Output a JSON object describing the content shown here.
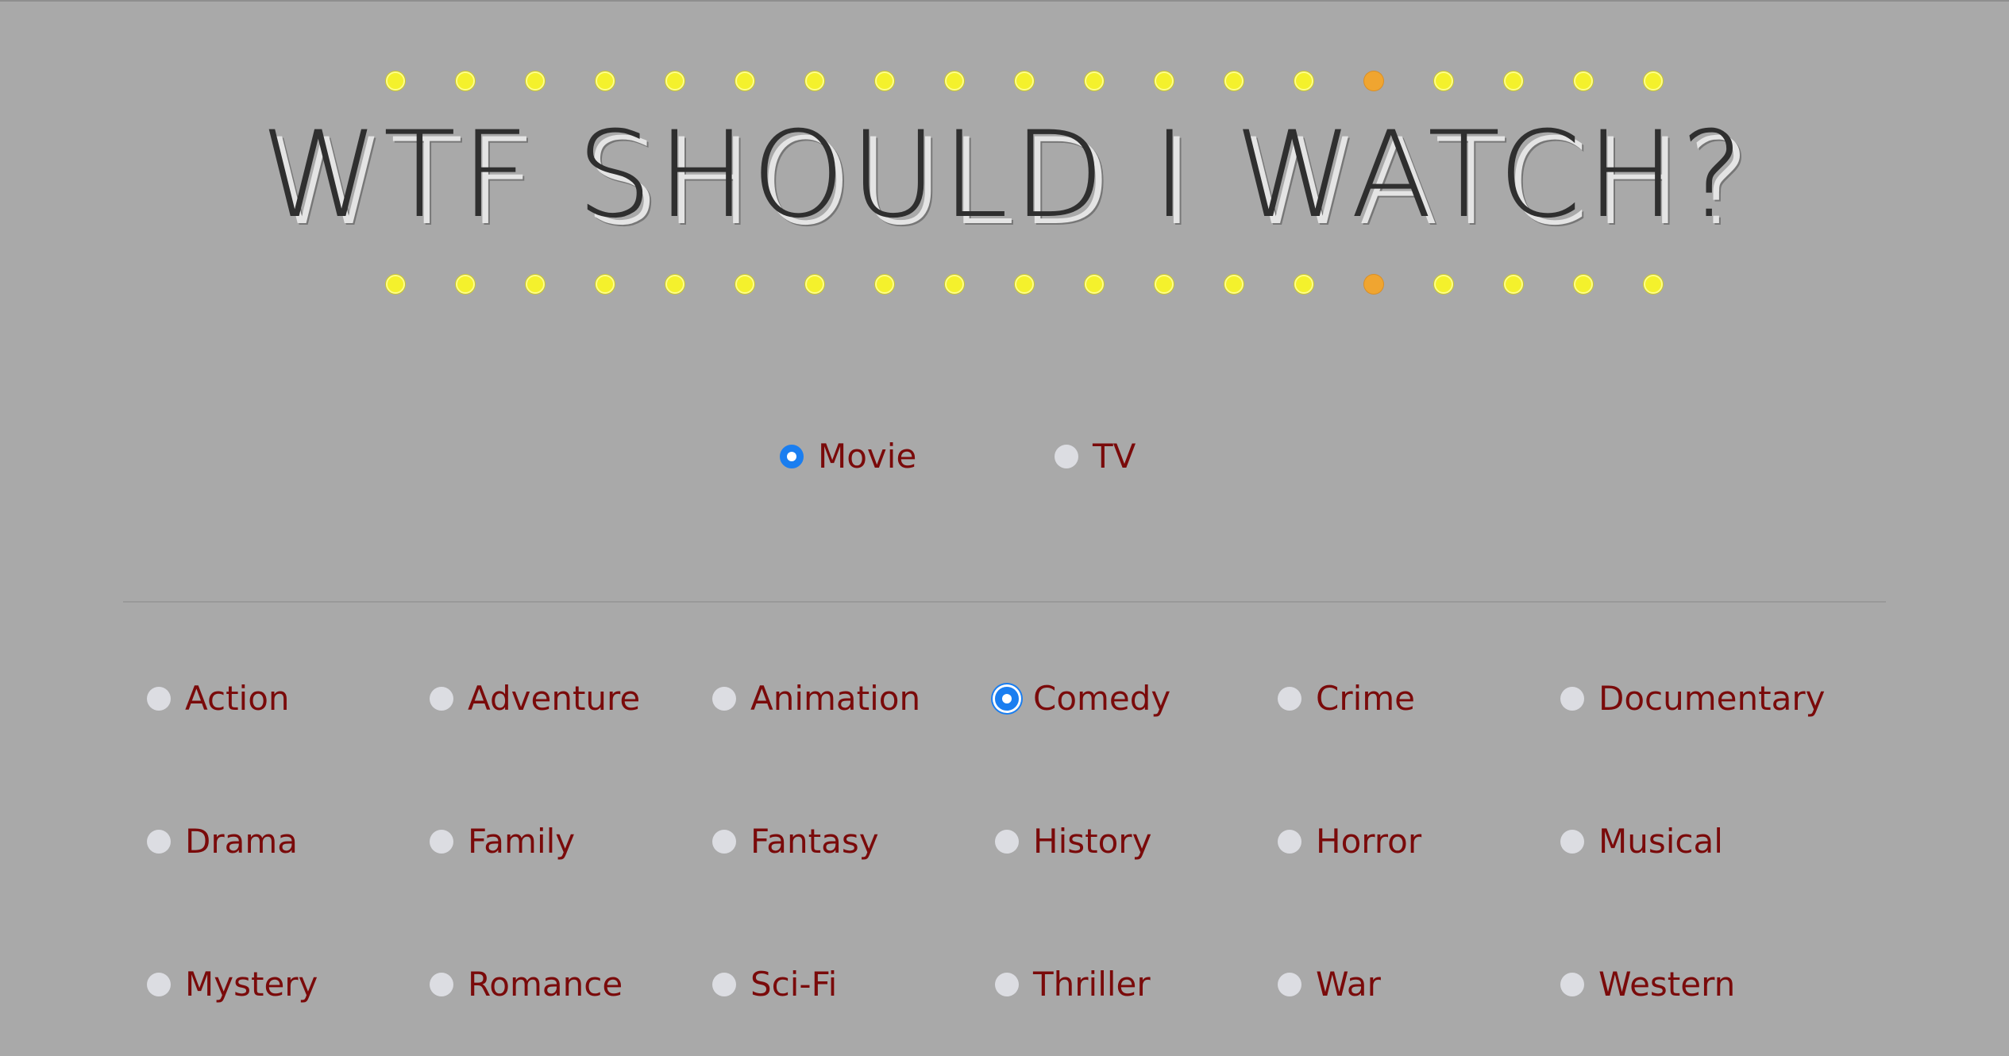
{
  "header": {
    "title": "WTF SHOULD I WATCH?",
    "marquee_bulbs_per_row": 19,
    "highlighted_bulb_number": 15,
    "colors": {
      "bulb": "#f4f12c",
      "bulb_highlight": "#f0a530"
    }
  },
  "media_type": {
    "options": [
      {
        "label": "Movie",
        "checked": true
      },
      {
        "label": "TV",
        "checked": false
      }
    ]
  },
  "genres": {
    "options": [
      {
        "label": "Action",
        "checked": false
      },
      {
        "label": "Adventure",
        "checked": false
      },
      {
        "label": "Animation",
        "checked": false
      },
      {
        "label": "Comedy",
        "checked": true
      },
      {
        "label": "Crime",
        "checked": false
      },
      {
        "label": "Documentary",
        "checked": false
      },
      {
        "label": "Drama",
        "checked": false
      },
      {
        "label": "Family",
        "checked": false
      },
      {
        "label": "Fantasy",
        "checked": false
      },
      {
        "label": "History",
        "checked": false
      },
      {
        "label": "Horror",
        "checked": false
      },
      {
        "label": "Musical",
        "checked": false
      },
      {
        "label": "Mystery",
        "checked": false
      },
      {
        "label": "Romance",
        "checked": false
      },
      {
        "label": "Sci-Fi",
        "checked": false
      },
      {
        "label": "Thriller",
        "checked": false
      },
      {
        "label": "War",
        "checked": false
      },
      {
        "label": "Western",
        "checked": false
      }
    ]
  },
  "theme": {
    "background": "#a9a9a9",
    "label_color": "#7a0a0a",
    "accent": "#1a7ef0"
  }
}
